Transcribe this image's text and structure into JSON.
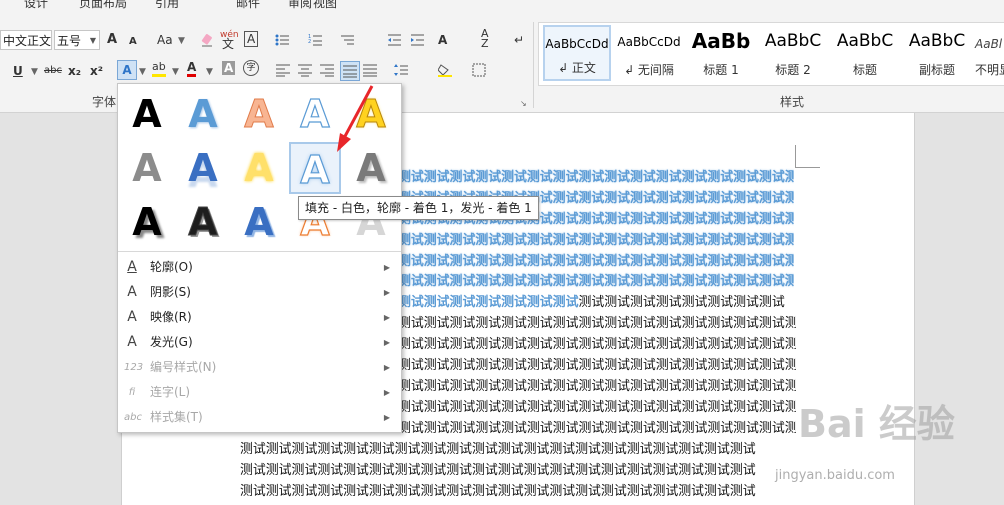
{
  "tabs": [
    "设计",
    "页面布局",
    "引用",
    "邮件",
    "审阅",
    "视图"
  ],
  "font": {
    "name": "中文正文",
    "size": "五号"
  },
  "groups": {
    "font": "字体",
    "styles": "样式"
  },
  "toolbar": {
    "grow": "A",
    "shrink": "A",
    "case": "Aa",
    "pinyin": "wén",
    "border_char": "A",
    "underline": "U",
    "strike": "abc",
    "sub": "x₂",
    "sup": "x²",
    "text_effect": "A",
    "highlight": "ab",
    "font_color": "A",
    "char_shade": "A",
    "enclose": "字"
  },
  "styles": [
    {
      "sample": "AaBbCcDd",
      "name": "↲ 正文",
      "selected": true
    },
    {
      "sample": "AaBbCcDd",
      "name": "↲ 无间隔",
      "selected": false
    },
    {
      "sample": "AaBb",
      "name": "标题 1",
      "selected": false
    },
    {
      "sample": "AaBbC",
      "name": "标题 2",
      "selected": false
    },
    {
      "sample": "AaBbC",
      "name": "标题",
      "selected": false
    },
    {
      "sample": "AaBbC",
      "name": "副标题",
      "selected": false
    },
    {
      "sample": "AaBl",
      "name": "不明显",
      "selected": false
    }
  ],
  "effects_gallery": {
    "letter": "A",
    "selected_index": 8,
    "tooltip": "填充 - 白色，轮廓 - 着色 1，发光 - 着色 1"
  },
  "menu": [
    {
      "icon": "outline-icon",
      "glyph": "A",
      "label": "轮廓(O)",
      "enabled": true
    },
    {
      "icon": "shadow-icon",
      "glyph": "A",
      "label": "阴影(S)",
      "enabled": true
    },
    {
      "icon": "reflection-icon",
      "glyph": "A",
      "label": "映像(R)",
      "enabled": true
    },
    {
      "icon": "glow-icon",
      "glyph": "A",
      "label": "发光(G)",
      "enabled": true
    },
    {
      "icon": "number-style-icon",
      "glyph": "123",
      "label": "编号样式(N)",
      "enabled": false
    },
    {
      "icon": "ligature-icon",
      "glyph": "fi",
      "label": "连字(L)",
      "enabled": false
    },
    {
      "icon": "stylistic-set-icon",
      "glyph": "abc",
      "label": "样式集(T)",
      "enabled": false
    }
  ],
  "document": {
    "line_text": "测试测试测试测试测试测试测试测试测试测试测试测试测试测试测试测试测试测试测试测试",
    "split_line_fx": "测试测试测试测试测试测试测试",
    "split_line_plain": "测试测试测试测试测试测试测试测试"
  },
  "watermark": {
    "brand": "Bai 经验",
    "url": "jingyan.baidu.com"
  }
}
